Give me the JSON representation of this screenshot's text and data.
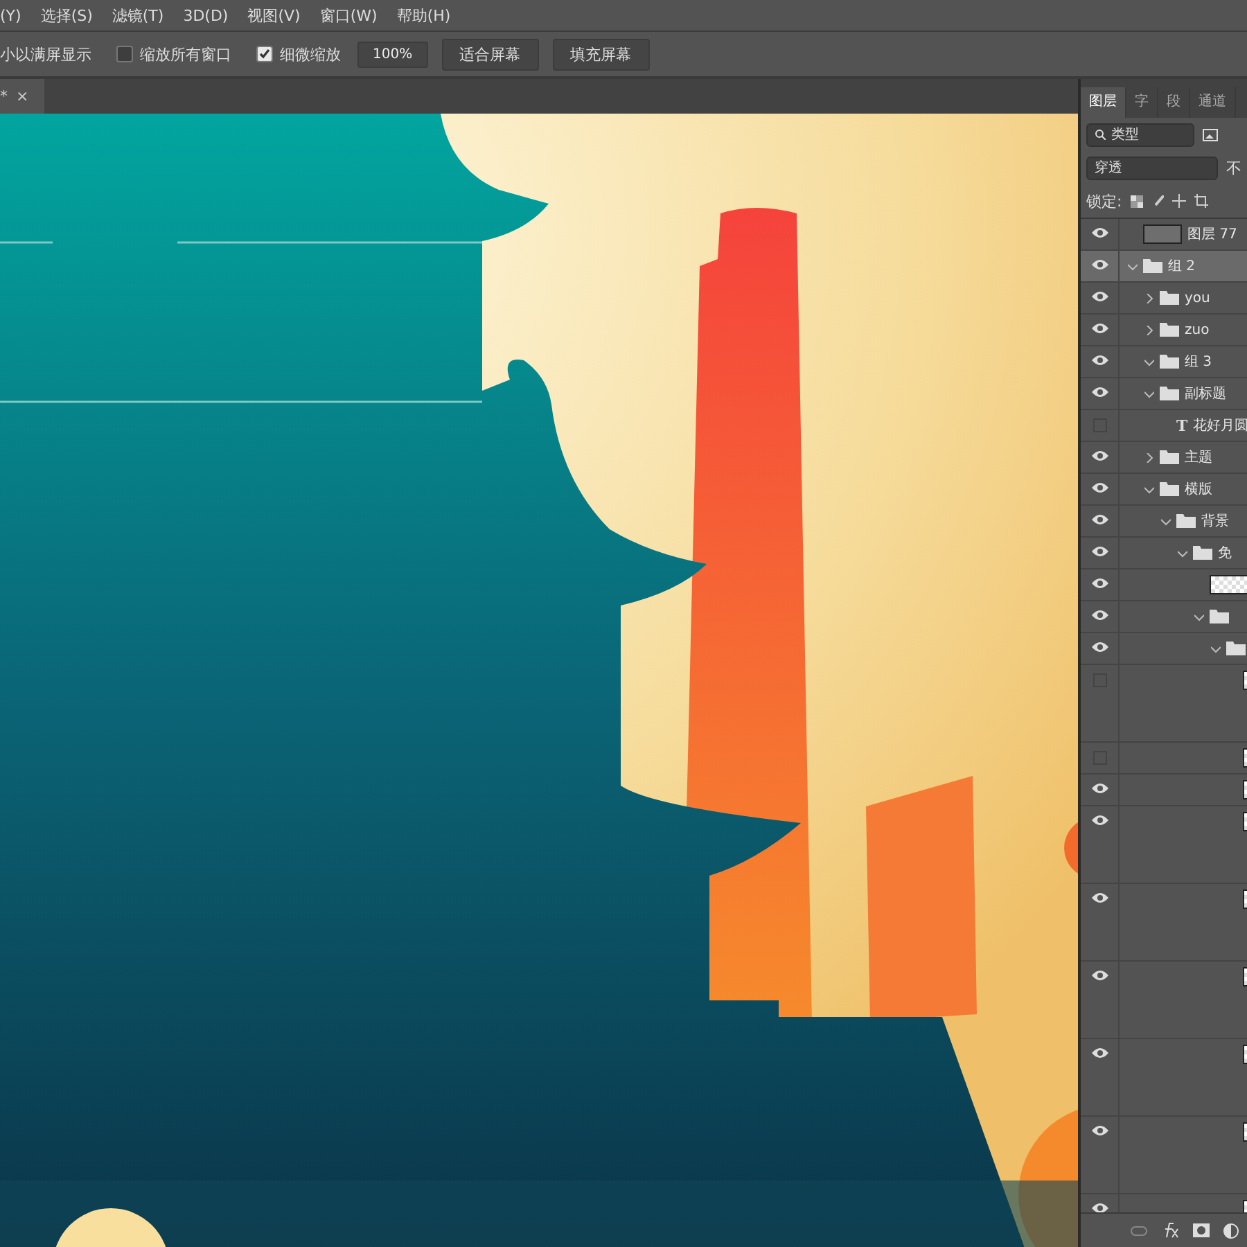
{
  "menu": [
    "(Y)",
    "选择(S)",
    "滤镜(T)",
    "3D(D)",
    "视图(V)",
    "窗口(W)",
    "帮助(H)"
  ],
  "options_bar": {
    "label": "小以满屏显示",
    "checkboxes": [
      {
        "label": "缩放所有窗口",
        "checked": false
      },
      {
        "label": "细微缩放",
        "checked": true
      }
    ],
    "zoom_value": "100%",
    "buttons": [
      "适合屏幕",
      "填充屏幕"
    ]
  },
  "document_tab": {
    "title": "*",
    "close": "×"
  },
  "panel": {
    "tabs": [
      {
        "label": "图层",
        "selected": true
      },
      {
        "label": "字",
        "selected": false
      },
      {
        "label": "段",
        "selected": false
      },
      {
        "label": "通道",
        "selected": false
      }
    ],
    "filter": {
      "value": "类型"
    },
    "blend_mode": {
      "value": "穿透"
    },
    "opacity_label": "不",
    "lock_label": "锁定:",
    "layers": [
      {
        "kind": "layer",
        "name": "图层 77",
        "visible": true,
        "selected": false
      },
      {
        "kind": "group",
        "name": "组 2",
        "visible": true,
        "selected": true,
        "expanded": true,
        "children": [
          {
            "kind": "group",
            "name": "you",
            "visible": true,
            "selected": false,
            "expanded": false
          },
          {
            "kind": "group",
            "name": "zuo",
            "visible": true,
            "selected": false,
            "expanded": false
          },
          {
            "kind": "group",
            "name": "组 3",
            "visible": true,
            "selected": false,
            "expanded": true
          },
          {
            "kind": "group",
            "name": "副标题",
            "visible": true,
            "selected": false,
            "expanded": true,
            "children": [
              {
                "kind": "text",
                "type_glyph": "T",
                "name": "花好月圆",
                "visible": false,
                "selected": false
              }
            ]
          },
          {
            "kind": "group",
            "name": "主题",
            "visible": true,
            "selected": false,
            "expanded": false
          },
          {
            "kind": "group",
            "name": "横版",
            "visible": true,
            "selected": false,
            "expanded": true,
            "children": [
              {
                "kind": "group",
                "name": "背景",
                "visible": true,
                "selected": false,
                "expanded": true,
                "children": [
                  {
                    "kind": "group",
                    "name": "免",
                    "visible": true,
                    "selected": false,
                    "expanded": true,
                    "children": [
                      {
                        "kind": "layer",
                        "visible": true,
                        "selected": false
                      },
                      {
                        "kind": "group",
                        "visible": true,
                        "selected": false,
                        "expanded": true,
                        "children": [
                          {
                            "kind": "group",
                            "visible": true,
                            "selected": false,
                            "expanded": true,
                            "children": [
                              {
                                "kind": "fx-layer",
                                "visible": false,
                                "selected": false
                              },
                              {
                                "kind": "layer",
                                "visible": false,
                                "selected": false
                              },
                              {
                                "kind": "layer",
                                "visible": true,
                                "selected": false
                              },
                              {
                                "kind": "fx-layer",
                                "visible": true,
                                "selected": false
                              },
                              {
                                "kind": "fx-layer",
                                "visible": true,
                                "selected": false
                              },
                              {
                                "kind": "fx-layer",
                                "visible": true,
                                "selected": false
                              },
                              {
                                "kind": "fx-layer",
                                "visible": true,
                                "selected": false
                              },
                              {
                                "kind": "fx-layer",
                                "visible": true,
                                "selected": false
                              },
                              {
                                "kind": "layer",
                                "visible": true,
                                "selected": false
                              }
                            ]
                          }
                        ]
                      }
                    ]
                  }
                ]
              }
            ]
          }
        ]
      }
    ]
  }
}
